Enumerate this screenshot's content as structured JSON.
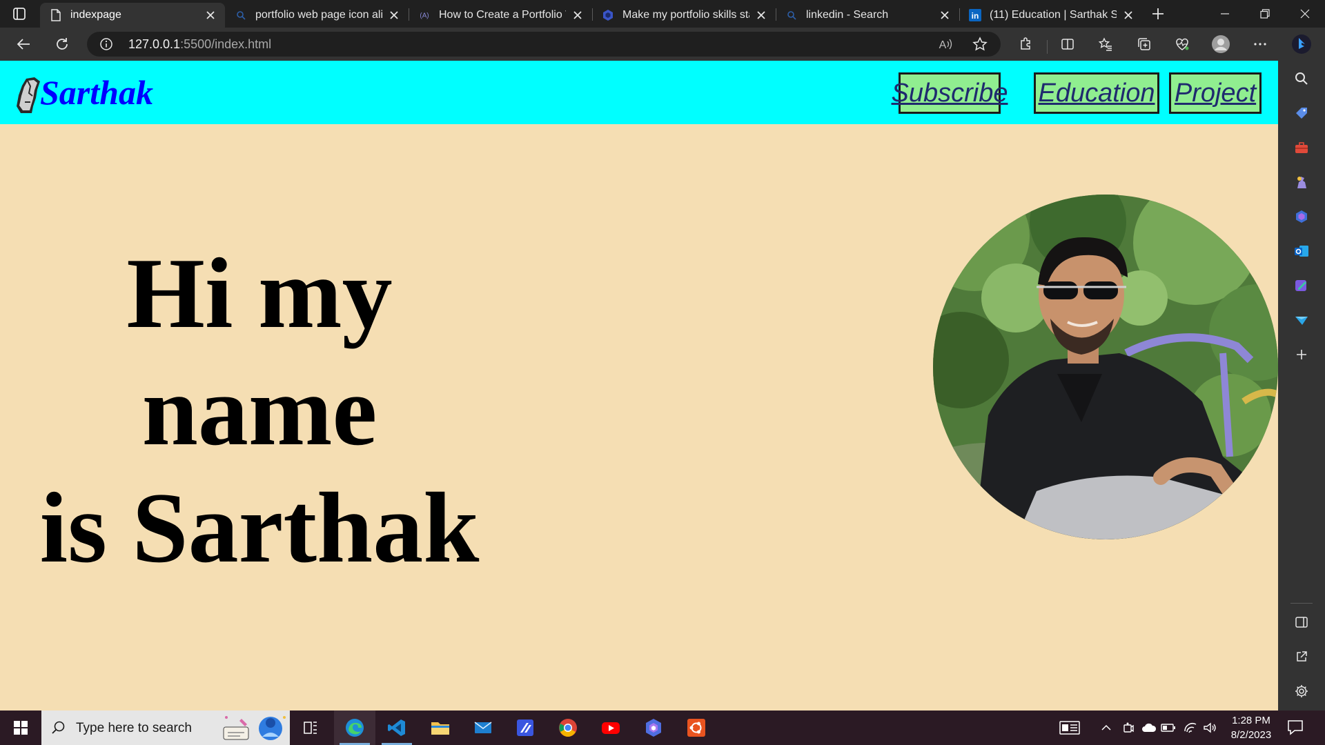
{
  "browser": {
    "tabs": [
      {
        "title": "indexpage",
        "icon": "page-icon",
        "active": true
      },
      {
        "title": "portfolio web page icon alig",
        "icon": "search-icon",
        "active": false
      },
      {
        "title": "How to Create a Portfolio W",
        "icon": "a-site-icon",
        "active": false
      },
      {
        "title": "Make my portfolio skills star",
        "icon": "bing-chat-icon",
        "active": false
      },
      {
        "title": "linkedin - Search",
        "icon": "search-icon",
        "active": false
      },
      {
        "title": "(11) Education | Sarthak Sin",
        "icon": "linkedin-icon",
        "active": false
      }
    ],
    "address": {
      "host": "127.0.0.1",
      "path": ":5500/index.html"
    },
    "read_aloud_label": "A"
  },
  "page": {
    "brand": "Sarthak",
    "nav": [
      "Subscribe",
      "Education",
      "Project"
    ],
    "hero_line1": "Hi my name",
    "hero_line2": "is Sarthak"
  },
  "taskbar": {
    "search_placeholder": "Type here to search",
    "time": "1:28 PM",
    "date": "8/2/2023"
  },
  "colors": {
    "page_background": "#f5deb3",
    "header_background": "#00ffff",
    "brand": "#0000ff",
    "nav_button": "#90ee90"
  }
}
